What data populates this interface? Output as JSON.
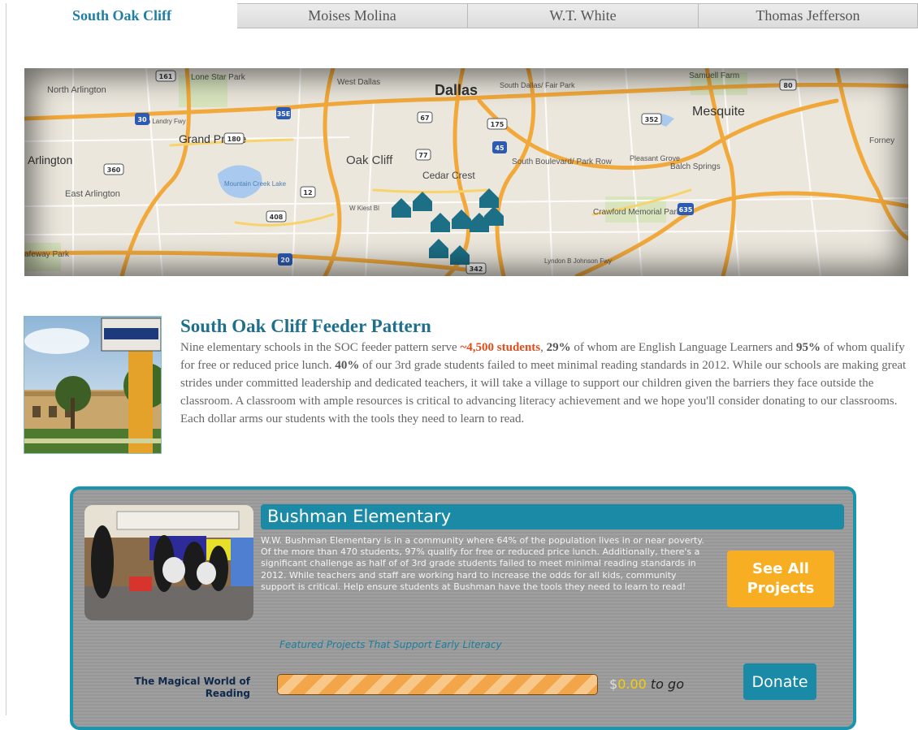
{
  "tabs": [
    {
      "label": "South Oak Cliff",
      "active": true
    },
    {
      "label": "Moises Molina",
      "active": false
    },
    {
      "label": "W.T. White",
      "active": false
    },
    {
      "label": "Thomas Jefferson",
      "active": false
    }
  ],
  "map": {
    "labels": {
      "north_arlington": "North Arlington",
      "lone_star_park": "Lone Star Park",
      "west_dallas": "West Dallas",
      "dallas": "Dallas",
      "south_dallas": "South Dallas/ Fair Park",
      "samuell_farm": "Samuell Farm",
      "mesquite": "Mesquite",
      "grand_prairie": "Grand Prairie",
      "arlington": "Arlington",
      "east_arlington": "East Arlington",
      "oak_cliff": "Oak Cliff",
      "cedar_crest": "Cedar Crest",
      "south_boulevard": "South Boulevard/ Park Row",
      "pleasant_grove": "Pleasant Grove",
      "balch_springs": "Balch Springs",
      "forney": "Forney",
      "mountain_creek_lake": "Mountain Creek Lake",
      "crawford_memorial_park": "Crawford Memorial Park",
      "tom_landry_fwy": "Tom Landry Fwy",
      "kiest": "W Kiest Bl",
      "safeway_park": "afeway Park",
      "lyndon_b_johnson_fwy": "Lyndon B Johnson Fwy"
    },
    "shields": [
      "161",
      "30",
      "35E",
      "67",
      "175",
      "352",
      "80",
      "45",
      "180",
      "360",
      "77",
      "12",
      "408",
      "20",
      "635",
      "342"
    ],
    "school_marker_count": 9
  },
  "feeder": {
    "title": "South Oak Cliff Feeder Pattern",
    "p1": "Nine elementary schools in the SOC feeder pattern serve ",
    "students": "~4,500 students",
    "p2": ", ",
    "ell_pct": "29%",
    "p3": " of whom are English Language Learners and ",
    "lunch_pct": "95%",
    "p4": " of whom qualify for free or reduced price lunch. ",
    "fail_pct": "40%",
    "p5": " of our 3rd grade students failed to meet minimal reading standards in 2012. While our schools are making great strides under committed leadership and dedicated teachers, it will take a village to support our children given the barriers they face outside the classroom. A classroom with ample resources is critical to advancing literacy achievement and we hope you'll consider donating to our classrooms. Each dollar arms our students with the tools they need to learn to read."
  },
  "school": {
    "name": "Bushman Elementary",
    "description": "W.W. Bushman Elementary is in a community where 64% of the population lives in or near poverty. Of the more than 470 students, 97% qualify for free or reduced price lunch. Additionally, there's a significant challenge as half of of 3rd grade students failed to meet minimal reading standards in 2012. While teachers and staff are working hard to increase the odds for all kids, community support is critical. Help ensure students at Bushman have the tools they need to learn to read!",
    "see_all_label": "See All Projects",
    "featured_label": "Featured Projects That Support Early Literacy",
    "project": {
      "name": "The Magical World of Reading",
      "progress": 1.0,
      "currency": "$",
      "amount_to_go": "0.00",
      "to_go_label": "to go",
      "donate_label": "Donate"
    }
  },
  "colors": {
    "brand_teal": "#1a8aa6",
    "highlight_orange": "#e04d1c",
    "button_orange": "#f7ae22",
    "card_gray": "#9c9c9c"
  }
}
